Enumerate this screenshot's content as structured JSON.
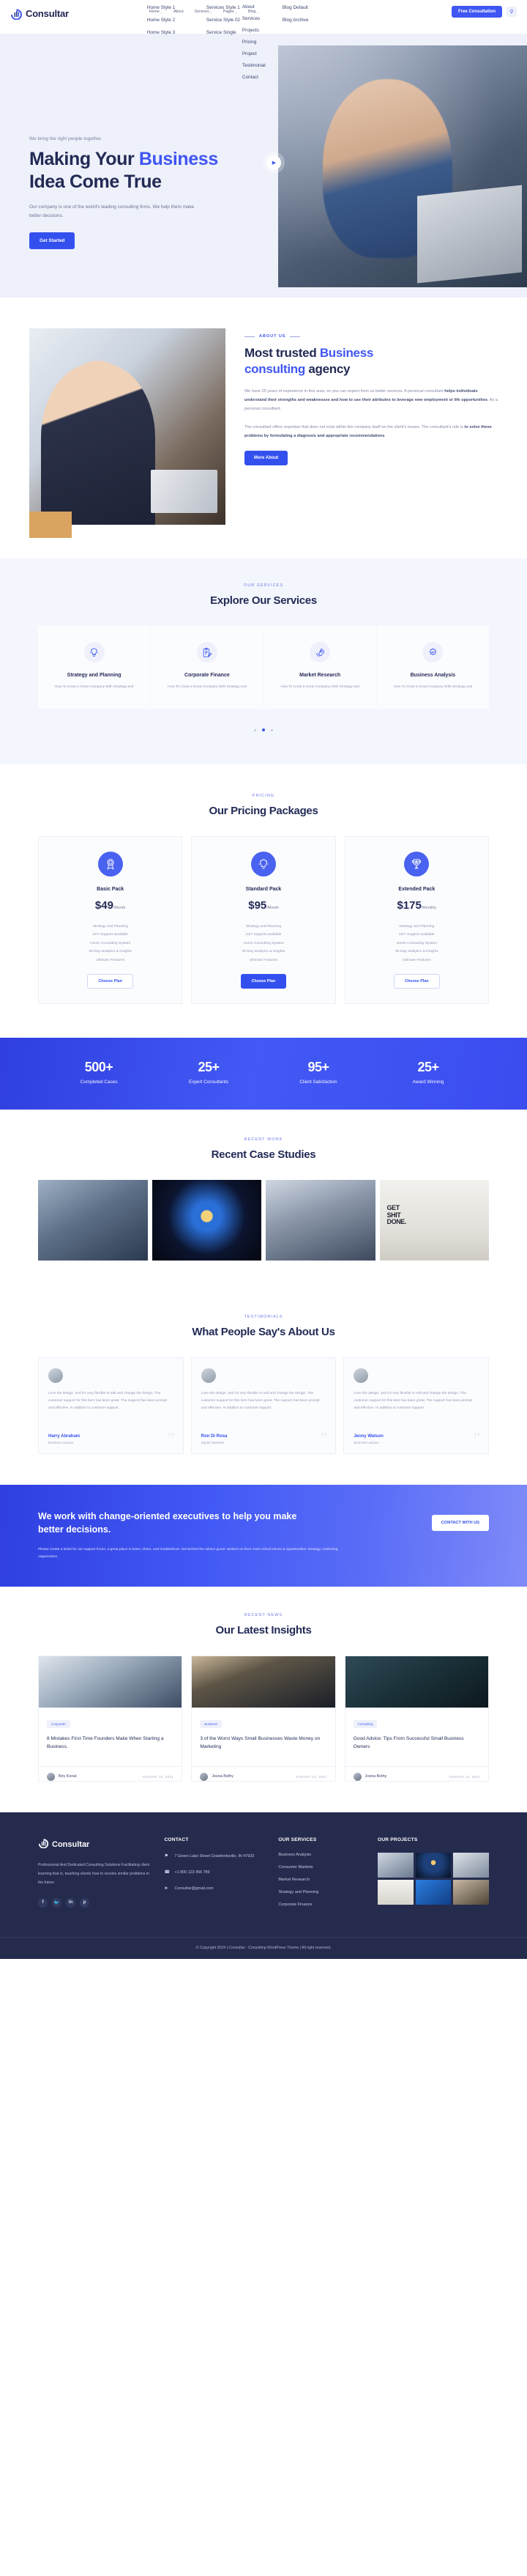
{
  "brand": {
    "name": "Consultar"
  },
  "header": {
    "nav": [
      {
        "label": "Home",
        "caret": "⌄",
        "submenu": [
          "Home Style 1",
          "Home Style 2",
          "Home Style 3"
        ]
      },
      {
        "label": "About",
        "caret": "",
        "submenu": []
      },
      {
        "label": "Services",
        "caret": "⌄",
        "submenu": [
          "Services Style 1",
          "Service Style 02",
          "Service Single"
        ]
      },
      {
        "label": "Pages",
        "caret": "⌄",
        "submenu": [
          "About",
          "Services",
          "Projects",
          "Pricing",
          "Project",
          "Testimonial",
          "Contact"
        ]
      },
      {
        "label": "Blog",
        "caret": "⌄",
        "submenu": [
          "Blog Default",
          "Blog Archive"
        ]
      }
    ],
    "consult_button": "Free Consultation",
    "search_icon": "⚲"
  },
  "hero": {
    "eyebrow": "We bring the right people together.",
    "title_line1_a": "Making Your ",
    "title_line1_b": "Business",
    "title_line2": "Idea Come True",
    "description": "Our company is one of the world's leading consulting firms. We help them make better decisions.",
    "cta": "Get Started",
    "play_icon": "▶"
  },
  "about": {
    "eyebrow": "About Us",
    "title_a": "Most trusted ",
    "title_b": "Business",
    "title_c": "consulting",
    "title_d": " agency",
    "paragraph1_plain_a": "We have 25 years of experience in this area, so you can expect from us better services. A personal consultant ",
    "paragraph1_bold": "helps individuals understand their strengths and weaknesses and how to use their attributes to leverage new employment or life opportunities",
    "paragraph1_plain_b": ". As a personal consultant.",
    "paragraph2_plain_a": "The consultant offers expertise that does not exist within the company itself  on the client's issues. The consultant's role is ",
    "paragraph2_bold": "to solve these problems by formulating a diagnosis and appropriate recommendations",
    "paragraph2_plain_b": "",
    "button": "More About"
  },
  "services": {
    "eyebrow": "Our Services",
    "title": "Explore Our Services",
    "cards": [
      {
        "name": "Strategy and Planning",
        "desc": "How To Creat a Great Company With Strategy and",
        "icon": "bulb-icon"
      },
      {
        "name": "Corporate Finance",
        "desc": "How To Creat a Great Company With Strategy and",
        "icon": "clipboard-icon"
      },
      {
        "name": "Market Research",
        "desc": "How To Creat a Great Company With Strategy and",
        "icon": "rocket-icon"
      },
      {
        "name": "Business Analysis",
        "desc": "How To Creat a Great Company With Strategy and",
        "icon": "gear-icon"
      }
    ]
  },
  "pricing": {
    "eyebrow": "Pricing",
    "title": "Our Pricing Packages",
    "plans": [
      {
        "name": "Basic Pack",
        "price": "$49",
        "period": "/Month",
        "icon": "badge-icon",
        "features": [
          "Strategy and Planning",
          "24/7 Support available",
          "Home Consulting System",
          "30-Day analytics & insights",
          "Ultimate Features"
        ],
        "button": "Choose Plan",
        "featured": false
      },
      {
        "name": "Standard Pack",
        "price": "$95",
        "period": "/Month",
        "icon": "bulb-icon",
        "features": [
          "Strategy and Planning",
          "24/7 Support available",
          "Home Consulting System",
          "30-Day analytics & insights",
          "Ultimate Features"
        ],
        "button": "Choose Plan",
        "featured": true
      },
      {
        "name": "Extended Pack",
        "price": "$175",
        "period": "/Monthly",
        "icon": "trophy-icon",
        "features": [
          "Strategy and Planning",
          "24/7 Support available",
          "Home Consulting System",
          "30-Day analytics & insights",
          "Ultimate Features"
        ],
        "button": "Choose Plan",
        "featured": false
      }
    ]
  },
  "counters": [
    {
      "value": "500+",
      "label": "Completed Cases"
    },
    {
      "value": "25+",
      "label": "Expert Consultants"
    },
    {
      "value": "95+",
      "label": "Client Satisfaction"
    },
    {
      "value": "25+",
      "label": "Award Winning"
    }
  ],
  "cases": {
    "eyebrow": "Recent Work",
    "title": "Recent Case Studies",
    "images": [
      "case-handshake",
      "case-lightbulb-network",
      "case-office-meeting",
      "case-get-shit-done-poster"
    ],
    "poster_text": "GET SHIT DONE."
  },
  "testimonials": {
    "eyebrow": "Testimonials",
    "title": "What People Say's About Us",
    "items": [
      {
        "text": "Love the design, and it's very flexible to edit and change the design. The customer support for this item has been great. The support has been prompt and effective. In addition to customer support.",
        "name": "Harry Abraham",
        "role": "Business advisor",
        "quote": "”"
      },
      {
        "text": "Love the design, and it's very flexible to edit and change the design. The customer support for this item has been great. The support has been prompt and effective. In addition to customer support.",
        "name": "Ron Di Rosa",
        "role": "Digital Marketer",
        "quote": "”"
      },
      {
        "text": "Love the design, and it's very flexible to edit and change the design. The customer support for this item has been great. The support has been prompt and effective. In addition to customer support.",
        "name": "Jenny Watson",
        "role": "Business advisor",
        "quote": "”"
      }
    ]
  },
  "cta": {
    "title": "We work with change-oriented executives to help you make better decisions.",
    "button": "CONTACT WITH US",
    "description": "Please create a ticket for our support forum, a great place to learn, share, and troubleshoot. Get behind the advice gurus' wisdom on their most critical issues & opportunities: strategy, marketing, organization."
  },
  "blog": {
    "eyebrow": "Recent News",
    "title": "Our Latest Insights",
    "posts": [
      {
        "tag": "Corporate",
        "title": "8 Mistakes First-Time Founders Make When Starting a Business.",
        "author": "Biry Konal",
        "date": "AUGUST 14, 2021"
      },
      {
        "tag": "Business",
        "title": "3 of the Worst Ways Small Businesses Waste Money on Marketing",
        "author": "Josna Bothy",
        "date": "AUGUST 14, 2021"
      },
      {
        "tag": "Consulting",
        "title": "Good Advice: Tips From Successful Small Business Owners",
        "author": "Josna Bothy",
        "date": "AUGUST 14, 2021"
      }
    ]
  },
  "footer": {
    "description": "Professional And Dedicated Consulting Solutions Facilitating client learning that is, teaching clients how to resolve similar problems in the future",
    "socials": [
      {
        "name": "facebook-icon",
        "glyph": "f"
      },
      {
        "name": "twitter-icon",
        "glyph": "🐦"
      },
      {
        "name": "linkedin-icon",
        "glyph": "in"
      },
      {
        "name": "pinterest-icon",
        "glyph": "ρ"
      }
    ],
    "contact": {
      "heading": "CONTACT",
      "items": [
        {
          "icon": "location-icon",
          "glyph": "⚑",
          "text": "7 Green Lake Street Crawfordsville, IN 47933"
        },
        {
          "icon": "phone-icon",
          "glyph": "☎",
          "text": "+1 800 123 456 789"
        },
        {
          "icon": "send-icon",
          "glyph": "➤",
          "text": "Consultar@gmail.com"
        }
      ]
    },
    "services": {
      "heading": "OUR SERVICES",
      "links": [
        "Business Analysis",
        "Consumer Markets",
        "Market Research",
        "Strategy and Planning",
        "Corporate Finance"
      ]
    },
    "projects": {
      "heading": "OUR PROJECTS",
      "thumbs": [
        "project-1",
        "project-2",
        "project-3",
        "project-4",
        "project-5",
        "project-6"
      ]
    },
    "copyright": "© Copyright 2024 | Consultar - Consulting WordPress Theme | All right reserved."
  },
  "colors": {
    "accent": "#3f56f2",
    "accent_dark": "#3350ef",
    "dark": "#242b4d",
    "light_bg": "#f4f6fd",
    "hero_bg": "#eef1fa"
  }
}
